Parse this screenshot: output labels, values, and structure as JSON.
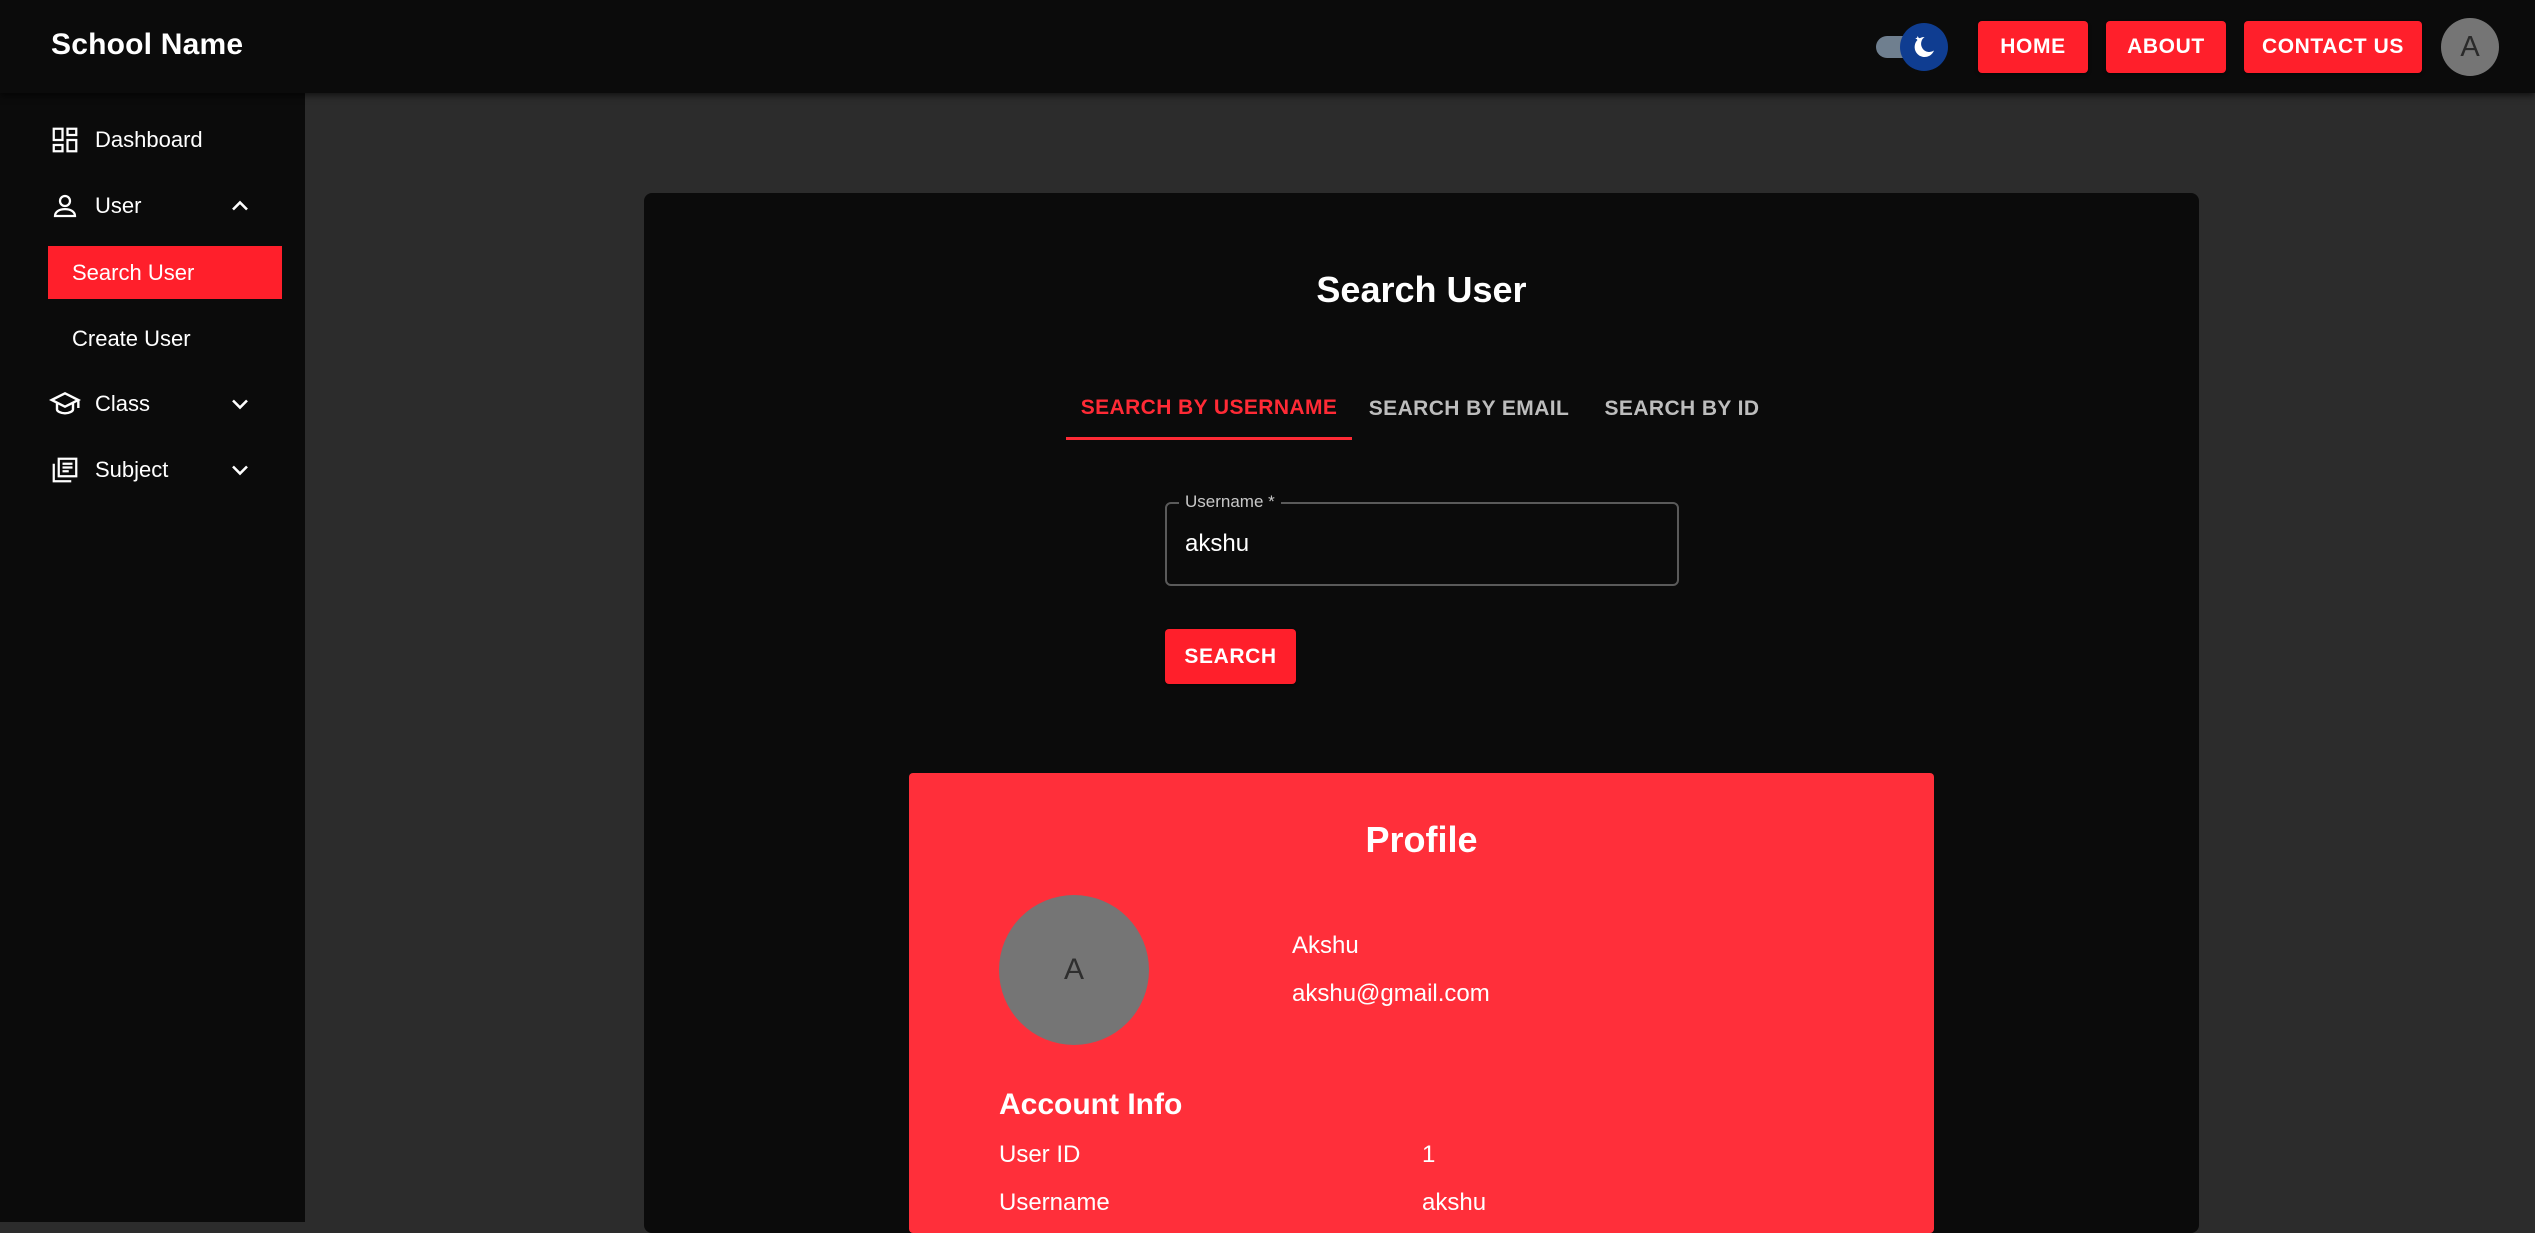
{
  "app": {
    "title": "School Name"
  },
  "header": {
    "nav": [
      {
        "label": "HOME"
      },
      {
        "label": "ABOUT"
      },
      {
        "label": "CONTACT US"
      }
    ],
    "avatar_letter": "A",
    "theme_mode": "dark"
  },
  "sidebar": {
    "items": [
      {
        "label": "Dashboard",
        "icon": "dashboard-icon"
      },
      {
        "label": "User",
        "icon": "person-icon",
        "expanded": true,
        "children": [
          {
            "label": "Search User",
            "active": true
          },
          {
            "label": "Create User"
          }
        ]
      },
      {
        "label": "Class",
        "icon": "school-icon",
        "expanded": false
      },
      {
        "label": "Subject",
        "icon": "library-books-icon",
        "expanded": false
      }
    ]
  },
  "main": {
    "title": "Search User",
    "tabs": [
      {
        "label": "SEARCH BY USERNAME",
        "active": true
      },
      {
        "label": "SEARCH BY EMAIL"
      },
      {
        "label": "SEARCH BY ID"
      }
    ],
    "username_field": {
      "label": "Username *",
      "value": "akshu"
    },
    "search_label": "SEARCH"
  },
  "profile": {
    "title": "Profile",
    "avatar_letter": "A",
    "name": "Akshu",
    "email": "akshu@gmail.com",
    "account_heading": "Account Info",
    "rows": [
      {
        "key": "User ID",
        "value": "1"
      },
      {
        "key": "Username",
        "value": "akshu"
      }
    ]
  },
  "colors": {
    "accent": "#ff1f2b",
    "profile_bg": "#ff2f3a",
    "surface": "#0b0b0b",
    "background": "#2c2c2c",
    "toggle_thumb": "#0f3d91"
  }
}
